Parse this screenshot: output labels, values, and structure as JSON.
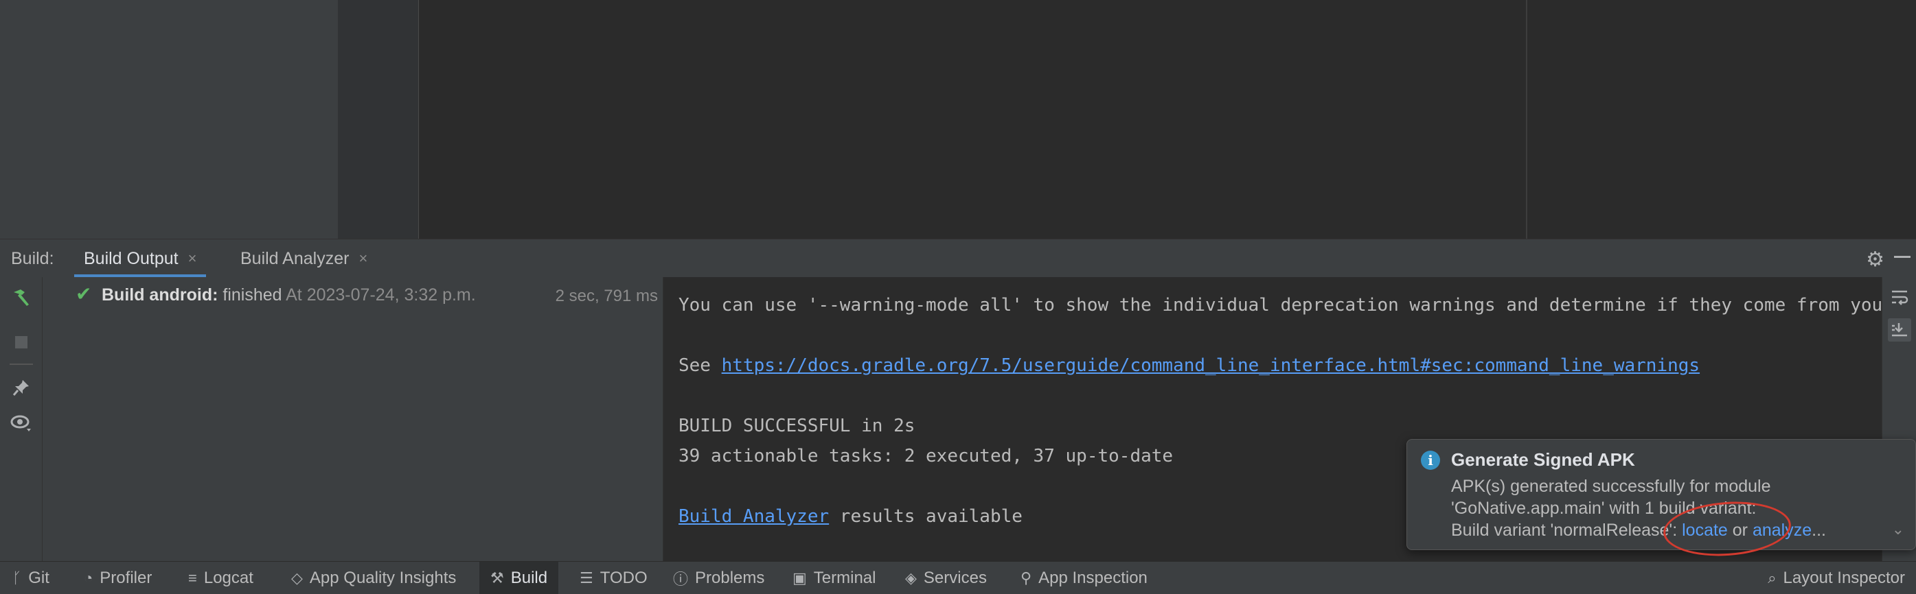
{
  "tool_window": {
    "title": "Build:",
    "tabs": [
      {
        "label": "Build Output",
        "close": "×"
      },
      {
        "label": "Build Analyzer",
        "close": "×"
      }
    ],
    "gear_icon": "⚙",
    "minimize_icon": "—"
  },
  "left_toolbar": {
    "icons": [
      "hammer-icon",
      "stop-icon",
      "pin-icon",
      "eye-icon"
    ]
  },
  "build_tree": {
    "root": {
      "status_icon": "✔",
      "name": "Build android:",
      "status": "finished",
      "timestamp": "At 2023-07-24, 3:32 p.m.",
      "duration": "2 sec, 791 ms"
    }
  },
  "console": {
    "line1": "You can use '--warning-mode all' to show the individual deprecation warnings and determine if they come from your own scripts or plugins.",
    "see_prefix": "See ",
    "see_link": "https://docs.gradle.org/7.5/userguide/command_line_interface.html#sec:command_line_warnings",
    "build_successful": "BUILD SUCCESSFUL in 2s",
    "tasks": "39 actionable tasks: 2 executed, 37 up-to-date",
    "analyzer_link": "Build Analyzer",
    "analyzer_suffix": " results available"
  },
  "notification": {
    "info_icon": "i",
    "title": "Generate Signed APK",
    "line1": "APK(s) generated successfully for module",
    "line2": "'GoNative.app.main' with 1 build variant:",
    "line3_prefix": "Build variant 'normalRelease': ",
    "locate_link": "locate",
    "or_text": " or ",
    "analyze_link": "analyze",
    "ellipsis": "...",
    "chevron": "⌄"
  },
  "statusbar": {
    "items": [
      {
        "label": "Git",
        "icon": "ᚴ"
      },
      {
        "label": "Profiler",
        "icon": "◔"
      },
      {
        "label": "Logcat",
        "icon": "≡"
      },
      {
        "label": "App Quality Insights",
        "icon": "◇"
      },
      {
        "label": "Build",
        "icon": "⚒"
      },
      {
        "label": "TODO",
        "icon": "☰"
      },
      {
        "label": "Problems",
        "icon": "ⓘ"
      },
      {
        "label": "Terminal",
        "icon": "▣"
      },
      {
        "label": "Services",
        "icon": "◈"
      },
      {
        "label": "App Inspection",
        "icon": "⚲"
      },
      {
        "label": "Layout Inspector",
        "icon": "⌕"
      }
    ]
  },
  "colors": {
    "accent": "#4a88c7",
    "link": "#589df6",
    "success": "#5fb865",
    "annotation": "#d33b2f"
  }
}
